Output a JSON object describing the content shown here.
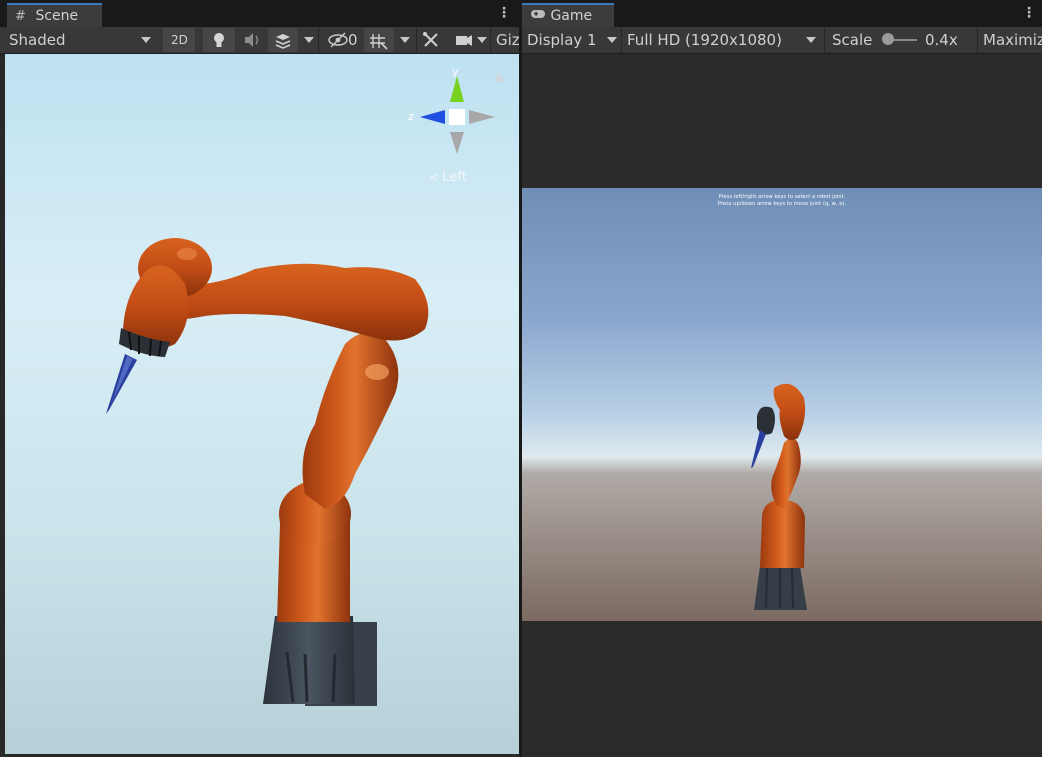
{
  "scene": {
    "tab_title": "Scene",
    "shading_mode": "Shaded",
    "mode_2d": "2D",
    "hidden_count": "0",
    "gizmos_label": "Giz",
    "view_label": "Left",
    "axis_y": "y",
    "axis_z": "z"
  },
  "game": {
    "tab_title": "Game",
    "display": "Display 1",
    "resolution": "Full HD (1920x1080)",
    "scale_label": "Scale",
    "scale_value": "0.4x",
    "maximize_label": "Maximiz",
    "instruction_line1": "Press left/right arrow keys to select a robot joint.",
    "instruction_line2": "Press up/down arrow keys to move joint (q, w, e)."
  },
  "colors": {
    "robot_orange": "#c4521c",
    "robot_base": "#3e4650",
    "tool_blue": "#2a3f9e",
    "tab_accent": "#3a79bb"
  },
  "icons": [
    "grid-icon",
    "gamepad-icon",
    "kebab-menu-icon",
    "lightbulb-icon",
    "audio-icon",
    "effects-icon",
    "visibility-icon",
    "grid-snap-icon",
    "tools-icon",
    "camera-icon",
    "lock-icon"
  ]
}
